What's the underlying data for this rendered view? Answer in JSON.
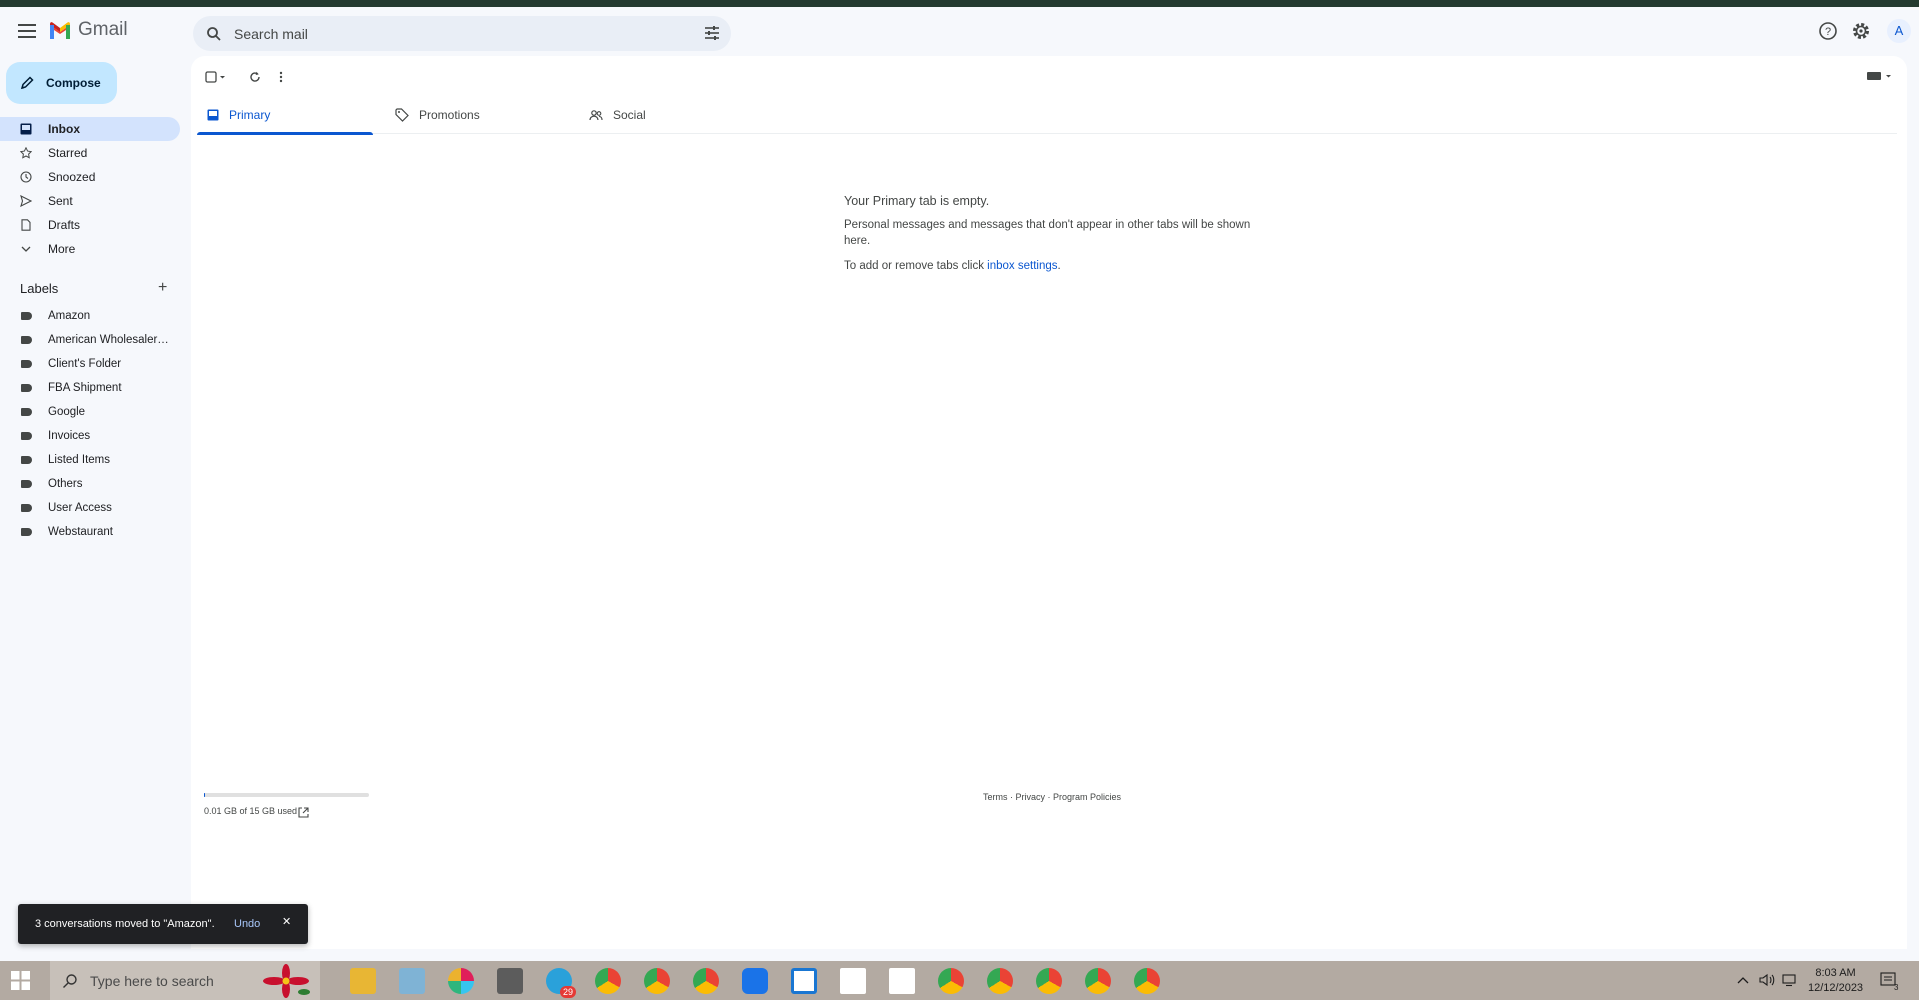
{
  "app": {
    "name": "Gmail",
    "colors": {
      "accent": "#0b57d0",
      "compose_bg": "#c2e7ff",
      "active_nav": "#d3e3fd",
      "canvas": "#f6f8fc",
      "taskbar": "#b3aaa2"
    }
  },
  "header": {
    "search_placeholder": "Search mail",
    "avatar_letter": "A",
    "icons": [
      "menu-icon",
      "search-icon",
      "tune-icon",
      "help-icon",
      "settings-icon"
    ]
  },
  "sidebar": {
    "compose_label": "Compose",
    "items": [
      {
        "label": "Inbox",
        "icon": "inbox-icon",
        "active": true
      },
      {
        "label": "Starred",
        "icon": "star-icon"
      },
      {
        "label": "Snoozed",
        "icon": "clock-icon"
      },
      {
        "label": "Sent",
        "icon": "send-icon"
      },
      {
        "label": "Drafts",
        "icon": "draft-icon"
      },
      {
        "label": "More",
        "icon": "chevron-down-icon"
      }
    ],
    "labels_heading": "Labels",
    "labels_add": "+",
    "labels": [
      "Amazon",
      "American Wholesalers ...",
      "Client's Folder",
      "FBA Shipment",
      "Google",
      "Invoices",
      "Listed Items",
      "Others",
      "User Access",
      "Webstaurant"
    ]
  },
  "main": {
    "tabs": [
      {
        "label": "Primary",
        "icon": "inbox-icon",
        "active": true
      },
      {
        "label": "Promotions",
        "icon": "tag-icon"
      },
      {
        "label": "Social",
        "icon": "people-icon"
      }
    ],
    "empty_state": {
      "title": "Your Primary tab is empty.",
      "body": "Personal messages and messages that don't appear in other tabs will be shown here.",
      "settings_prefix": "To add or remove tabs click ",
      "settings_link": "inbox settings",
      "settings_suffix": "."
    },
    "storage": {
      "text": "0.01 GB of 15 GB used",
      "used_fraction": 0.0007
    },
    "footer": {
      "terms": "Terms",
      "sep1": " · ",
      "privacy": "Privacy",
      "sep2": " · ",
      "policies": "Program Policies"
    }
  },
  "snackbar": {
    "message": "3 conversations moved to \"Amazon\".",
    "undo": "Undo",
    "close": "✕"
  },
  "taskbar": {
    "search_placeholder": "Type here to search",
    "badge_count": "29",
    "time": "8:03 AM",
    "date": "12/12/2023",
    "notification_count": "3",
    "apps": [
      "file-explorer-icon",
      "notepad-icon",
      "slack-icon",
      "calculator-icon",
      "telegram-icon",
      "chrome-icon",
      "chrome-icon",
      "chrome-icon",
      "zoom-icon",
      "r-app-icon",
      "pdf-icon",
      "pdf-icon",
      "chrome-icon",
      "chrome-icon",
      "chrome-icon",
      "chrome-icon",
      "chrome-icon"
    ]
  }
}
